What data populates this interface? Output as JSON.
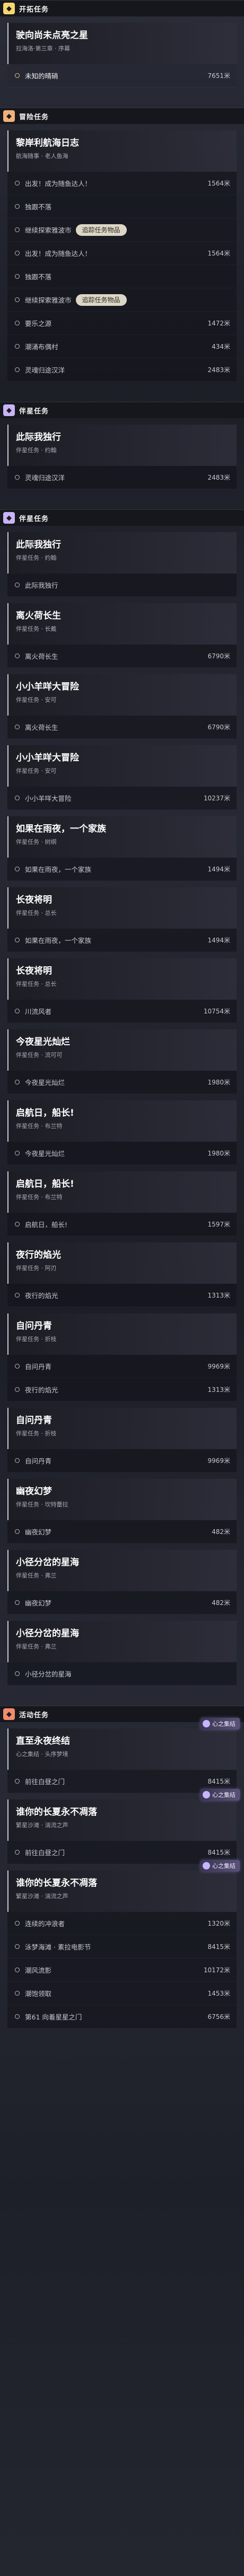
{
  "sections": [
    {
      "key": "trailblaze",
      "title": "开拓任务",
      "icon": "trailblaze-mission-icon",
      "icon_color": "#f5d76e",
      "quests": [
        {
          "title": "驶向尚未点亮之星",
          "subtitle": "拉海洛·第三章 · 序幕",
          "objectives": [
            {
              "text": "未知的晴硝",
              "distance": "7651米",
              "active": true,
              "tracked": false
            }
          ]
        }
      ]
    },
    {
      "key": "companion-side",
      "title": "冒险任务",
      "icon": "adventure-mission-icon",
      "icon_color": "#f0b27a",
      "quests": [
        {
          "title": "黎岸利航海日志",
          "subtitle": "航海随事 · 老人鱼海",
          "objectives": [
            {
              "text": "出发！成为随鱼达人！",
              "distance": "1564米",
              "active": false,
              "tracked": false
            },
            {
              "text": "独跟不落",
              "distance": "",
              "active": false,
              "tracked": false
            },
            {
              "text": "继续探索雅波市",
              "distance": "",
              "active": false,
              "tracked": false,
              "tag": "追踪任务物品"
            },
            {
              "text": "出发！成为随鱼达人！",
              "distance": "1564米",
              "active": false,
              "tracked": false
            },
            {
              "text": "独跟不落",
              "distance": "",
              "active": false,
              "tracked": false
            },
            {
              "text": "继续探索雅波市",
              "distance": "",
              "active": false,
              "tracked": false,
              "tag": "追踪任务物品"
            },
            {
              "text": "要乐之源",
              "distance": "1472米",
              "active": false,
              "tracked": false
            },
            {
              "text": "潮涌布偶村",
              "distance": "434米",
              "active": false,
              "tracked": false
            },
            {
              "text": "灵魂归途汉洋",
              "distance": "2483米",
              "active": false,
              "tracked": false
            }
          ]
        }
      ]
    },
    {
      "key": "companion",
      "title": "伴星任务",
      "icon": "companion-mission-icon",
      "icon_color": "#c8b4f5",
      "quests": [
        {
          "title": "此际我独行",
          "subtitle": "伴星任务 · 约翰",
          "objectives": [
            {
              "text": "灵魂归途汉洋",
              "distance": "2483米",
              "active": false,
              "tracked": false
            }
          ]
        }
      ]
    },
    {
      "key": "companion2",
      "title": "伴星任务",
      "icon": "companion-mission-icon",
      "icon_color": "#c8b4f5",
      "quests": [
        {
          "title": "此际我独行",
          "subtitle": "伴星任务 · 约翰",
          "objectives": [
            {
              "text": "此际我独行",
              "distance": "",
              "active": false,
              "tracked": false
            }
          ]
        },
        {
          "title": "离火荷长生",
          "subtitle": "伴星任务 · 长戴",
          "objectives": [
            {
              "text": "离火荷长生",
              "distance": "6790米",
              "active": false,
              "tracked": false
            }
          ]
        },
        {
          "title": "小小羊咩大冒险",
          "subtitle": "伴星任务 · 安可",
          "objectives": [
            {
              "text": "离火荷长生",
              "distance": "6790米",
              "active": false,
              "tracked": false
            }
          ]
        },
        {
          "title": "小小羊咩大冒险",
          "subtitle": "伴星任务 · 安可",
          "objectives": [
            {
              "text": "小小羊咩大冒险",
              "distance": "10237米",
              "active": false,
              "tracked": false
            }
          ]
        },
        {
          "title": "如果在雨夜，一个家族",
          "subtitle": "伴星任务 · 树纲",
          "objectives": [
            {
              "text": "如果在雨夜，一个家族",
              "distance": "1494米",
              "active": false,
              "tracked": false
            }
          ]
        },
        {
          "title": "长夜将明",
          "subtitle": "伴星任务 · 总长",
          "objectives": [
            {
              "text": "如果在雨夜，一个家族",
              "distance": "1494米",
              "active": false,
              "tracked": false
            }
          ]
        },
        {
          "title": "长夜将明",
          "subtitle": "伴星任务 · 总长",
          "objectives": [
            {
              "text": "川流风者",
              "distance": "10754米",
              "active": false,
              "tracked": false
            }
          ]
        },
        {
          "title": "今夜星光灿烂",
          "subtitle": "伴星任务 · 流可可",
          "objectives": [
            {
              "text": "今夜星光灿烂",
              "distance": "1980米",
              "active": false,
              "tracked": false
            }
          ]
        },
        {
          "title": "启航日，船长!",
          "subtitle": "伴星任务 · 布兰特",
          "objectives": [
            {
              "text": "今夜星光灿烂",
              "distance": "1980米",
              "active": false,
              "tracked": false
            }
          ]
        },
        {
          "title": "启航日，船长!",
          "subtitle": "伴星任务 · 布兰特",
          "objectives": [
            {
              "text": "启航日，船长!",
              "distance": "1597米",
              "active": false,
              "tracked": false
            }
          ]
        },
        {
          "title": "夜行的焰光",
          "subtitle": "伴星任务 · 阿刃",
          "objectives": [
            {
              "text": "夜行的焰光",
              "distance": "1313米",
              "active": false,
              "tracked": false
            }
          ]
        },
        {
          "title": "自问丹青",
          "subtitle": "伴星任务 · 折枝",
          "objectives": [
            {
              "text": "自问丹青",
              "distance": "9969米",
              "active": false,
              "tracked": false
            },
            {
              "text": "夜行的焰光",
              "distance": "1313米",
              "active": false,
              "tracked": false
            }
          ]
        },
        {
          "title": "自问丹青",
          "subtitle": "伴星任务 · 折枝",
          "objectives": [
            {
              "text": "自问丹青",
              "distance": "9969米",
              "active": false,
              "tracked": false
            }
          ]
        },
        {
          "title": "幽夜幻梦",
          "subtitle": "伴星任务 · 坎特蕾拉",
          "objectives": [
            {
              "text": "幽夜幻梦",
              "distance": "482米",
              "active": false,
              "tracked": false
            }
          ]
        },
        {
          "title": "小径分岔的星海",
          "subtitle": "伴星任务 · 弗兰",
          "objectives": [
            {
              "text": "幽夜幻梦",
              "distance": "482米",
              "active": false,
              "tracked": false
            }
          ]
        },
        {
          "title": "小径分岔的星海",
          "subtitle": "伴星任务 · 弗兰",
          "objectives": [
            {
              "text": "小径分岔的星海",
              "distance": "",
              "active": false,
              "tracked": false
            }
          ]
        }
      ]
    },
    {
      "key": "event",
      "title": "活动任务",
      "icon": "event-mission-icon",
      "icon_color": "#f28b6b",
      "quests": [
        {
          "title": "直至永夜终结",
          "subtitle": "心之集结 · 头序梦境",
          "tag": "心之集结",
          "objectives": [
            {
              "text": "前往白昼之门",
              "distance": "8415米",
              "active": false,
              "tracked": false
            }
          ]
        },
        {
          "title": "谁你的长夏永不凋落",
          "subtitle": "繁星沙滩 · 湍流之声",
          "tag": "心之集结",
          "objectives": [
            {
              "text": "前往白昼之门",
              "distance": "8415米",
              "active": false,
              "tracked": false
            }
          ]
        },
        {
          "title": "谁你的长夏永不凋落",
          "subtitle": "繁星沙滩 · 湍流之声",
          "tag": "心之集结",
          "objectives": [
            {
              "text": "连续的冲浪者",
              "distance": "1320米",
              "active": false,
              "tracked": false
            },
            {
              "text": "泳梦海滩 · 素拉电影节",
              "distance": "8415米",
              "active": false,
              "tracked": false
            },
            {
              "text": "潮风流影",
              "distance": "10172米",
              "active": false,
              "tracked": false
            },
            {
              "text": "潮饱领取",
              "distance": "1453米",
              "active": false,
              "tracked": false
            },
            {
              "text": "第61 向着星星之门",
              "distance": "6756米",
              "active": false,
              "tracked": false
            }
          ]
        }
      ]
    }
  ]
}
